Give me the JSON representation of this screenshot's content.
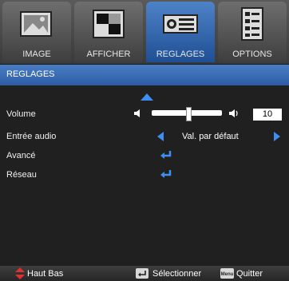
{
  "tabs": [
    {
      "label": "IMAGE",
      "icon": "image-picture-icon",
      "active": false
    },
    {
      "label": "AFFICHER",
      "icon": "display-pattern-icon",
      "active": false
    },
    {
      "label": "REGLAGES",
      "icon": "projector-settings-icon",
      "active": true
    },
    {
      "label": "OPTIONS",
      "icon": "options-list-icon",
      "active": false
    }
  ],
  "section_title": "REGLAGES",
  "rows": {
    "volume": {
      "label": "Volume",
      "value": "10",
      "level": 0.5
    },
    "audio_input": {
      "label": "Entrée audio",
      "value": "Val. par défaut"
    },
    "advanced": {
      "label": "Avancé"
    },
    "network": {
      "label": "Réseau"
    }
  },
  "footer": {
    "nav_label": "Haut Bas",
    "select_label": "Sélectionner",
    "menu_key": "Menu",
    "quit_label": "Quitter"
  },
  "colors": {
    "accent": "#3d8ff2",
    "active_tab": "#2f63ad"
  }
}
